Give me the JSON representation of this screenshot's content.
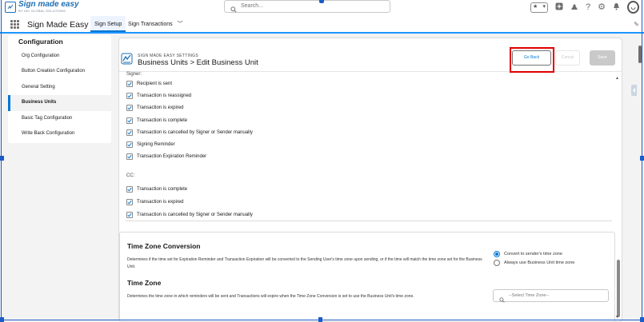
{
  "global_header": {
    "logo_name": "Sign made easy",
    "logo_sub": "BY HIC GLOBAL SOLUTIONS",
    "search_placeholder": "Search...",
    "icons": [
      "favorites-icon",
      "add-icon",
      "trailhead-icon",
      "help-icon",
      "setup-gear-icon",
      "notifications-bell-icon",
      "avatar"
    ]
  },
  "app_nav": {
    "app_name": "Sign Made Easy",
    "tabs": [
      {
        "label": "Sign Setup",
        "active": true
      },
      {
        "label": "Sign Transactions",
        "has_dropdown": true
      }
    ]
  },
  "sidebar": {
    "title": "Configuration",
    "items": [
      {
        "label": "Org Configuration"
      },
      {
        "label": "Button Creation Configuration"
      },
      {
        "label": "General Setting"
      },
      {
        "label": "Business Units",
        "active": true
      },
      {
        "label": "Basic Tag Configuration"
      },
      {
        "label": "Write Back Configuration"
      }
    ]
  },
  "page": {
    "eyebrow": "SIGN MADE EASY SETTINGS",
    "title": "Business Units > Edit Business Unit",
    "buttons": {
      "back": "Go Back",
      "cancel": "Cancel",
      "save": "Save"
    }
  },
  "notifications": {
    "signer_label": "Signer:",
    "signer": [
      {
        "label": "Recipient is sent",
        "checked": true
      },
      {
        "label": "Transaction is reassigned",
        "checked": true
      },
      {
        "label": "Transaction is expired",
        "checked": true
      },
      {
        "label": "Transaction is complete",
        "checked": true
      },
      {
        "label": "Transaction is cancelled by Signer or Sender manually",
        "checked": true
      },
      {
        "label": "Signing Reminder",
        "checked": true
      },
      {
        "label": "Transaction Expiration Reminder",
        "checked": true
      }
    ],
    "cc_label": "CC:",
    "cc": [
      {
        "label": "Transaction is complete",
        "checked": true
      },
      {
        "label": "Transaction is expired",
        "checked": true
      },
      {
        "label": "Transaction is cancelled by Signer or Sender manually",
        "checked": true
      }
    ]
  },
  "time_zone_conversion": {
    "title": "Time Zone Conversion",
    "description": "Determines if the time set for Expiration Reminder and Transaction Expiration will be converted to the Sending User's time zone upon sending, or if the time will match the time zone set for the Business Unit.",
    "options": [
      {
        "label": "Convert to sender's time zone",
        "selected": true
      },
      {
        "label": "Always use Business Unit time zone",
        "selected": false
      }
    ]
  },
  "time_zone": {
    "title": "Time Zone",
    "description": "Determines the time zone in which reminders will be sent and Transactions will expire when the Time Zone Conversion is set to use the Business Unit's time zone.",
    "select_placeholder": "--Select Time Zone--"
  },
  "colors": {
    "brand_blue": "#0176d3",
    "highlight_red": "#e00000",
    "selection_blue": "#1b5cc7"
  }
}
